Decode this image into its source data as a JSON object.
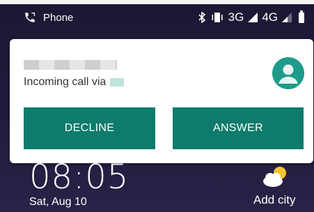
{
  "status_bar": {
    "app_label": "Phone",
    "network_3g": "3G",
    "network_4g": "4G"
  },
  "incoming_call": {
    "via_text": "Incoming call via",
    "decline_label": "DECLINE",
    "answer_label": "ANSWER"
  },
  "lock_screen": {
    "time": "08:05",
    "date": "Sat, Aug 10",
    "weather_action": "Add city"
  },
  "colors": {
    "accent": "#0f7b6c",
    "avatar": "#1e9b8a",
    "background": "#1c1833"
  },
  "icons": [
    "phone-icon",
    "bluetooth-icon",
    "vibrate-icon",
    "signal-icon",
    "battery-icon",
    "contact-avatar-icon",
    "weather-icon"
  ]
}
